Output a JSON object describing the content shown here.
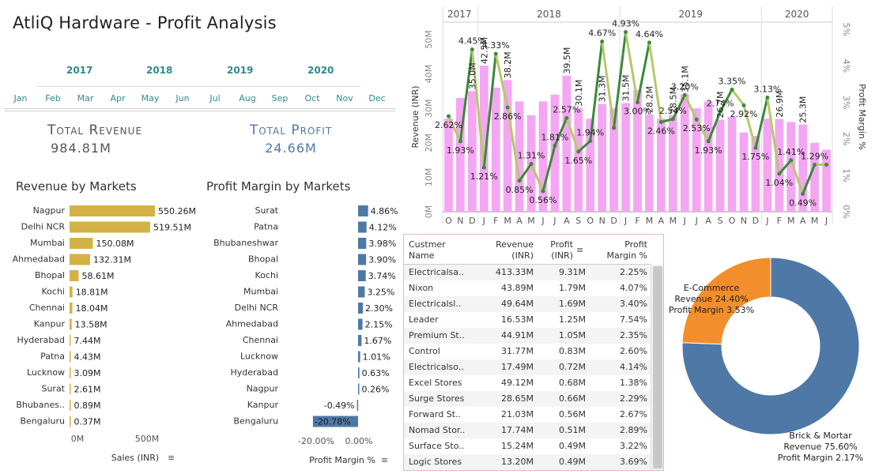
{
  "header": {
    "title": "AtliQ Hardware - Profit Analysis"
  },
  "filters": {
    "years": [
      "2017",
      "2018",
      "2019",
      "2020"
    ],
    "months": [
      "Jan",
      "Feb",
      "Mar",
      "Apr",
      "May",
      "Jun",
      "Jul",
      "Aug",
      "Sep",
      "Oct",
      "Nov",
      "Dec"
    ]
  },
  "kpis": {
    "revenue_label": "Total Revenue",
    "revenue_value": "984.81M",
    "profit_label": "Total Profit",
    "profit_value": "24.66M"
  },
  "colors": {
    "revenue_bar": "#d4b247",
    "margin_bar": "#4e79a7",
    "trend_bar": "#f4a6f2",
    "margin_line_up": "#3a8a3a",
    "margin_line_down": "#b5c96a",
    "donut_brick": "#4e79a7",
    "donut_ecom": "#f28e2b",
    "kpi_revenue": "#555555",
    "kpi_profit": "#4e79a7"
  },
  "chart_data": [
    {
      "type": "bar",
      "title": "Revenue by Markets",
      "categories": [
        "Nagpur",
        "Delhi NCR",
        "Mumbai",
        "Ahmedabad",
        "Bhopal",
        "Kochi",
        "Chennai",
        "Kanpur",
        "Hyderabad",
        "Patna",
        "Lucknow",
        "Surat",
        "Bhubanes..",
        "Bengaluru"
      ],
      "values": [
        550.26,
        519.51,
        150.08,
        132.31,
        58.61,
        18.81,
        18.04,
        13.58,
        7.44,
        4.43,
        3.09,
        2.61,
        0.89,
        0.37
      ],
      "labels": [
        "550.26M",
        "519.51M",
        "150.08M",
        "132.31M",
        "58.61M",
        "18.81M",
        "18.04M",
        "13.58M",
        "7.44M",
        "4.43M",
        "3.09M",
        "2.61M",
        "0.89M",
        "0.37M"
      ],
      "xlabel": "Sales (INR)",
      "ticks": [
        "0M",
        "500M"
      ],
      "xlim": [
        0,
        600
      ]
    },
    {
      "type": "bar",
      "title": "Profit Margin by Markets",
      "categories": [
        "Surat",
        "Patna",
        "Bhubaneshwar",
        "Bhopal",
        "Kochi",
        "Mumbai",
        "Delhi NCR",
        "Ahmedabad",
        "Chennai",
        "Lucknow",
        "Hyderabad",
        "Nagpur",
        "Kanpur",
        "Bengaluru"
      ],
      "values": [
        4.86,
        4.12,
        3.98,
        3.9,
        3.74,
        3.25,
        2.3,
        2.15,
        1.67,
        1.01,
        0.63,
        0.26,
        -0.49,
        -20.78
      ],
      "labels": [
        "4.86%",
        "4.12%",
        "3.98%",
        "3.90%",
        "3.74%",
        "3.25%",
        "2.30%",
        "2.15%",
        "1.67%",
        "1.01%",
        "0.63%",
        "0.26%",
        "-0.49%",
        "-20.78%"
      ],
      "xlabel": "Profit Margin %",
      "ticks": [
        "-20.00%",
        "0.00%"
      ],
      "xlim": [
        -21.5,
        2
      ]
    },
    {
      "type": "bar",
      "subtype": "bar-line-combo",
      "year_headers": [
        {
          "label": "2017",
          "months": 3
        },
        {
          "label": "2018",
          "months": 12
        },
        {
          "label": "2019",
          "months": 12
        },
        {
          "label": "2020",
          "months": 6
        }
      ],
      "x": [
        "O",
        "N",
        "D",
        "J",
        "F",
        "M",
        "A",
        "M",
        "J",
        "J",
        "A",
        "S",
        "O",
        "N",
        "D",
        "J",
        "F",
        "M",
        "A",
        "M",
        "J",
        "J",
        "A",
        "S",
        "O",
        "N",
        "D",
        "J",
        "F",
        "M",
        "A",
        "M",
        "J"
      ],
      "revenue": [
        27,
        33,
        35,
        42.4,
        36,
        38.2,
        32,
        28,
        32,
        34,
        39.5,
        30.1,
        27,
        31.3,
        30,
        31.5,
        35.3,
        28.2,
        27,
        28,
        34.1,
        30,
        32,
        26.7,
        27.5,
        23,
        22,
        27,
        26.9,
        26,
        25.3,
        20,
        18
      ],
      "revenue_labels": [
        "",
        "",
        "35.0M",
        "42.5M",
        "",
        "38.2M",
        "",
        "",
        "",
        "",
        "39.5M",
        "30.1M",
        "",
        "31.3M",
        "",
        "31.5M",
        "",
        "28.2M",
        "",
        "28.5M",
        "35.1M",
        "",
        "",
        "26.7M",
        "",
        "",
        "",
        "",
        "26.9M",
        "",
        "25.3M",
        "",
        ""
      ],
      "margin": [
        2.62,
        1.93,
        4.45,
        1.21,
        4.33,
        2.86,
        0.85,
        1.31,
        0.56,
        1.81,
        2.57,
        1.65,
        1.94,
        4.67,
        2.3,
        4.93,
        3.0,
        4.64,
        2.46,
        2.54,
        3.2,
        2.53,
        1.93,
        2.74,
        3.35,
        2.92,
        1.75,
        3.13,
        1.04,
        1.41,
        0.49,
        1.29,
        1.29
      ],
      "margin_labels": [
        "2.62%",
        "1.93%",
        "4.45%",
        "1.21%",
        "4.33%",
        "2.86%",
        "0.85%",
        "1.31%",
        "0.56%",
        "1.81%",
        "2.57%",
        "1.65%",
        "1.94%",
        "4.67%",
        "",
        "4.93%",
        "3.00%",
        "4.64%",
        "2.46%",
        "2.54%",
        "3.20%",
        "2.53%",
        "1.93%",
        "2.74%",
        "3.35%",
        "2.92%",
        "1.75%",
        "3.13%",
        "1.04%",
        "1.41%",
        "0.49%",
        "1.29%",
        ""
      ],
      "ylabel": "Revenue (INR)",
      "y2label": "Profit Margin %",
      "ylim": [
        0,
        55
      ],
      "y2lim": [
        0,
        5.2
      ],
      "yticks": [
        "0M",
        "10M",
        "20M",
        "30M",
        "40M",
        "50M"
      ],
      "y2ticks": [
        "0%",
        "1%",
        "2%",
        "3%",
        "4%",
        "5%"
      ]
    },
    {
      "type": "pie",
      "subtype": "donut",
      "slices": [
        {
          "name": "Brick & Mortar",
          "revenue": 75.6,
          "margin": 2.17
        },
        {
          "name": "E-Commerce",
          "revenue": 24.4,
          "margin": 3.53
        }
      ]
    }
  ],
  "table": {
    "headers": [
      "Custmer\nName",
      "Revenue\n(INR)",
      "Profit\n(INR)",
      "Profit\nMargin %"
    ],
    "rows": [
      [
        "Electricalsa..",
        "413.33M",
        "9.31M",
        "2.25%"
      ],
      [
        "Nixon",
        "43.89M",
        "1.79M",
        "4.07%"
      ],
      [
        "Electricalsl..",
        "49.64M",
        "1.69M",
        "3.40%"
      ],
      [
        "Leader",
        "16.53M",
        "1.25M",
        "7.54%"
      ],
      [
        "Premium St..",
        "44.91M",
        "1.05M",
        "2.35%"
      ],
      [
        "Control",
        "31.77M",
        "0.83M",
        "2.60%"
      ],
      [
        "Electricalso..",
        "17.49M",
        "0.72M",
        "4.14%"
      ],
      [
        "Excel Stores",
        "49.12M",
        "0.68M",
        "1.38%"
      ],
      [
        "Surge Stores",
        "28.65M",
        "0.66M",
        "2.29%"
      ],
      [
        "Forward St..",
        "21.03M",
        "0.56M",
        "2.67%"
      ],
      [
        "Nomad Stor..",
        "17.74M",
        "0.51M",
        "2.89%"
      ],
      [
        "Surface Sto..",
        "15.24M",
        "0.49M",
        "3.22%"
      ],
      [
        "Logic Stores",
        "13.20M",
        "0.49M",
        "3.69%"
      ]
    ]
  },
  "donut_labels": {
    "ecom": [
      "E-Commerce",
      "Revenue 24.40%",
      "Profit Margin 3.53%"
    ],
    "brick": [
      "Brick & Mortar",
      "Revenue 75.60%",
      "Profit Margin 2.17%"
    ]
  },
  "icons": {
    "sort": "sort-descending-icon"
  }
}
